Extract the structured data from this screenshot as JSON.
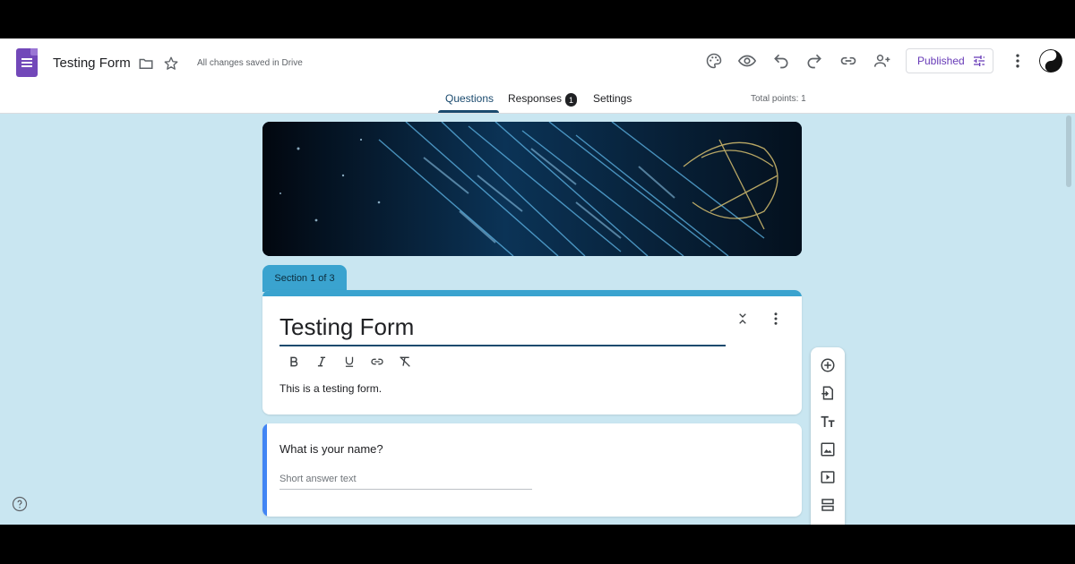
{
  "header": {
    "doc_title": "Testing Form",
    "saved_status": "All changes saved in Drive",
    "published_label": "Published"
  },
  "tabs": [
    {
      "label": "Questions",
      "active": true
    },
    {
      "label": "Responses",
      "badge": "1"
    },
    {
      "label": "Settings"
    }
  ],
  "total_points": "Total points: 1",
  "section": {
    "label": "Section 1 of 3",
    "title": "Testing Form",
    "description": "This is a testing form."
  },
  "question": {
    "title": "What is your name?",
    "answer_placeholder": "Short answer text"
  },
  "colors": {
    "accent": "#3aa3cf",
    "background": "#c9e6f1",
    "brand_purple": "#673ab7",
    "question_focus": "#4285f4"
  },
  "icons": {
    "header": [
      "forms-logo",
      "folder-icon",
      "star-icon",
      "palette-icon",
      "preview-eye-icon",
      "undo-icon",
      "redo-icon",
      "link-icon",
      "add-collaborator-icon",
      "more-vert-icon"
    ],
    "format": [
      "bold-icon",
      "italic-icon",
      "underline-icon",
      "link-icon",
      "clear-format-icon"
    ],
    "toolbar": [
      "add-question-icon",
      "import-questions-icon",
      "add-title-icon",
      "add-image-icon",
      "add-video-icon",
      "add-section-icon"
    ]
  }
}
